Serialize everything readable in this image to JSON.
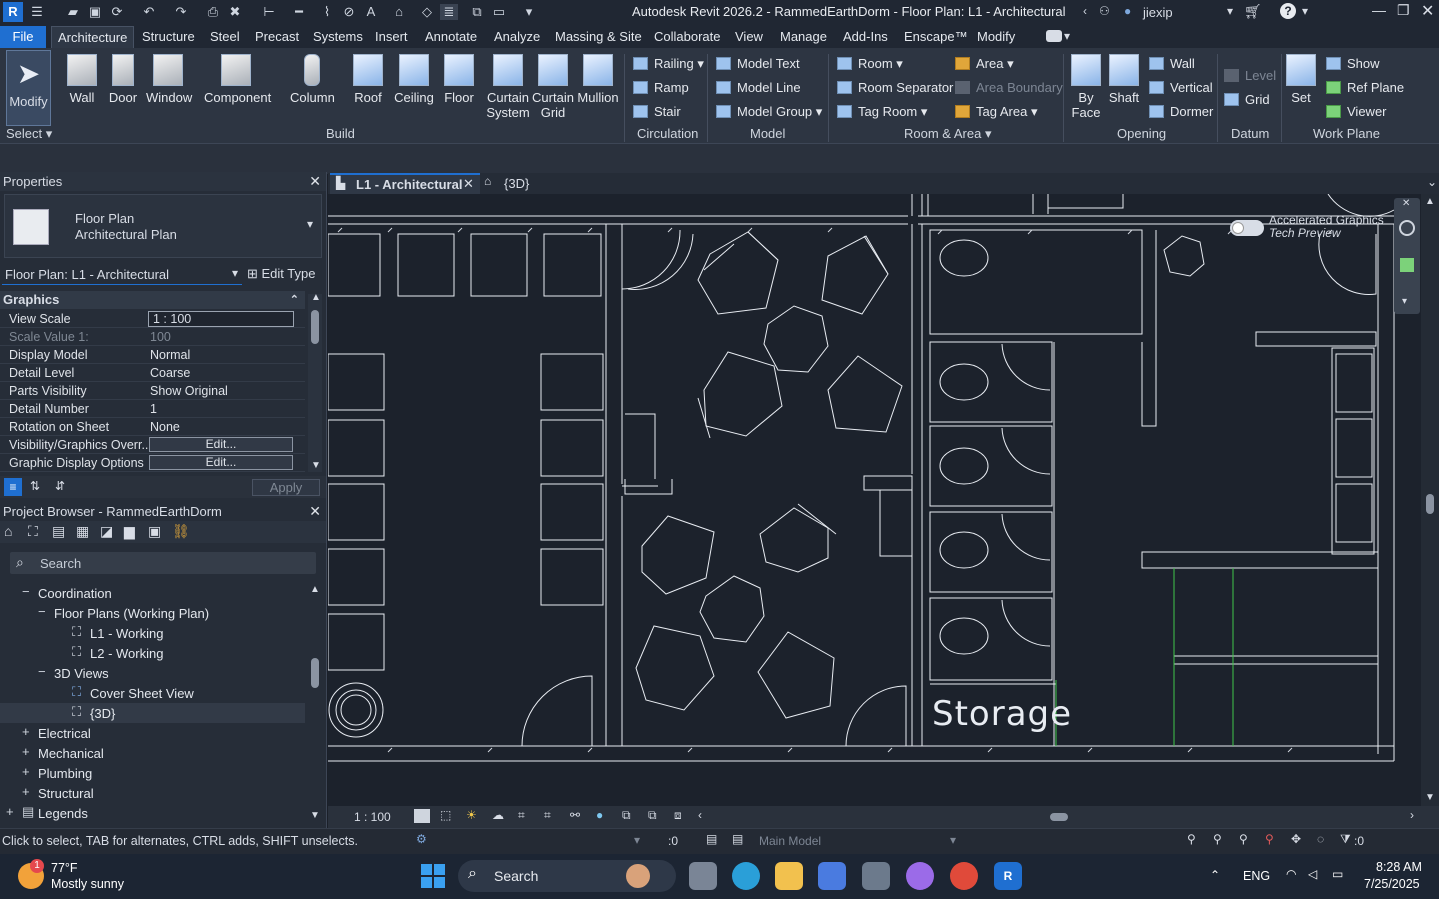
{
  "titlebar": {
    "title": "Autodesk Revit 2026.2 - RammedEarthDorm - Floor Plan: L1 - Architectural",
    "user": "jiexip"
  },
  "tabs": [
    "File",
    "Architecture",
    "Structure",
    "Steel",
    "Precast",
    "Systems",
    "Insert",
    "Annotate",
    "Analyze",
    "Massing & Site",
    "Collaborate",
    "View",
    "Manage",
    "Add-Ins",
    "Enscape™",
    "Modify"
  ],
  "ribbon": {
    "modify": "Modify",
    "select": "Select",
    "build": [
      "Wall",
      "Door",
      "Window",
      "Component",
      "Column",
      "Roof",
      "Ceiling",
      "Floor",
      "Curtain System",
      "Curtain Grid",
      "Mullion"
    ],
    "build_label": "Build",
    "circulation": [
      "Railing",
      "Ramp",
      "Stair"
    ],
    "circulation_label": "Circulation",
    "model": [
      "Model Text",
      "Model Line",
      "Model Group"
    ],
    "model_label": "Model",
    "room": [
      "Room",
      "Room Separator",
      "Tag Room"
    ],
    "area": [
      "Area",
      "Area Boundary",
      "Tag Area"
    ],
    "room_label": "Room & Area",
    "opening_big": [
      "By Face",
      "Shaft"
    ],
    "opening": [
      "Wall",
      "Vertical",
      "Dormer"
    ],
    "opening_label": "Opening",
    "datum": [
      "Level",
      "Grid"
    ],
    "datum_label": "Datum",
    "workplane_big": "Set",
    "workplane": [
      "Show",
      "Ref Plane",
      "Viewer"
    ],
    "workplane_label": "Work Plane"
  },
  "properties": {
    "title": "Properties",
    "type_line1": "Floor Plan",
    "type_line2": "Architectural Plan",
    "instance": "Floor Plan: L1 - Architectural",
    "edit_type": "Edit Type",
    "group": "Graphics",
    "rows": [
      {
        "k": "View Scale",
        "v": "1 : 100"
      },
      {
        "k": "Scale Value    1:",
        "v": "100"
      },
      {
        "k": "Display Model",
        "v": "Normal"
      },
      {
        "k": "Detail Level",
        "v": "Coarse"
      },
      {
        "k": "Parts Visibility",
        "v": "Show Original"
      },
      {
        "k": "Detail Number",
        "v": "1"
      },
      {
        "k": "Rotation on Sheet",
        "v": "None"
      },
      {
        "k": "Visibility/Graphics Overr...",
        "v": "Edit..."
      },
      {
        "k": "Graphic Display Options",
        "v": "Edit..."
      }
    ],
    "apply": "Apply"
  },
  "browser": {
    "title": "Project Browser - RammedEarthDorm",
    "search": "Search",
    "items": [
      "Coordination",
      "Floor Plans (Working Plan)",
      "L1 - Working",
      "L2 - Working",
      "3D Views",
      "Cover Sheet View",
      "{3D}",
      "Electrical",
      "Mechanical",
      "Plumbing",
      "Structural",
      "Legends"
    ]
  },
  "view_tabs": [
    "L1 - Architectural",
    "{3D}"
  ],
  "canvas": {
    "room_label": "Storage",
    "accel_line1": "Accelerated Graphics",
    "accel_line2": "Tech Preview"
  },
  "viewbar": {
    "scale": "1 : 100"
  },
  "status": {
    "hint": "Click to select, TAB for alternates, CTRL adds, SHIFT unselects.",
    "worksets": ":0",
    "model": "Main Model",
    "filter": ":0"
  },
  "taskbar": {
    "temp": "77°F",
    "weather": "Mostly sunny",
    "badge": "1",
    "search": "Search",
    "lang": "ENG",
    "time": "8:28 AM",
    "date": "7/25/2025"
  }
}
